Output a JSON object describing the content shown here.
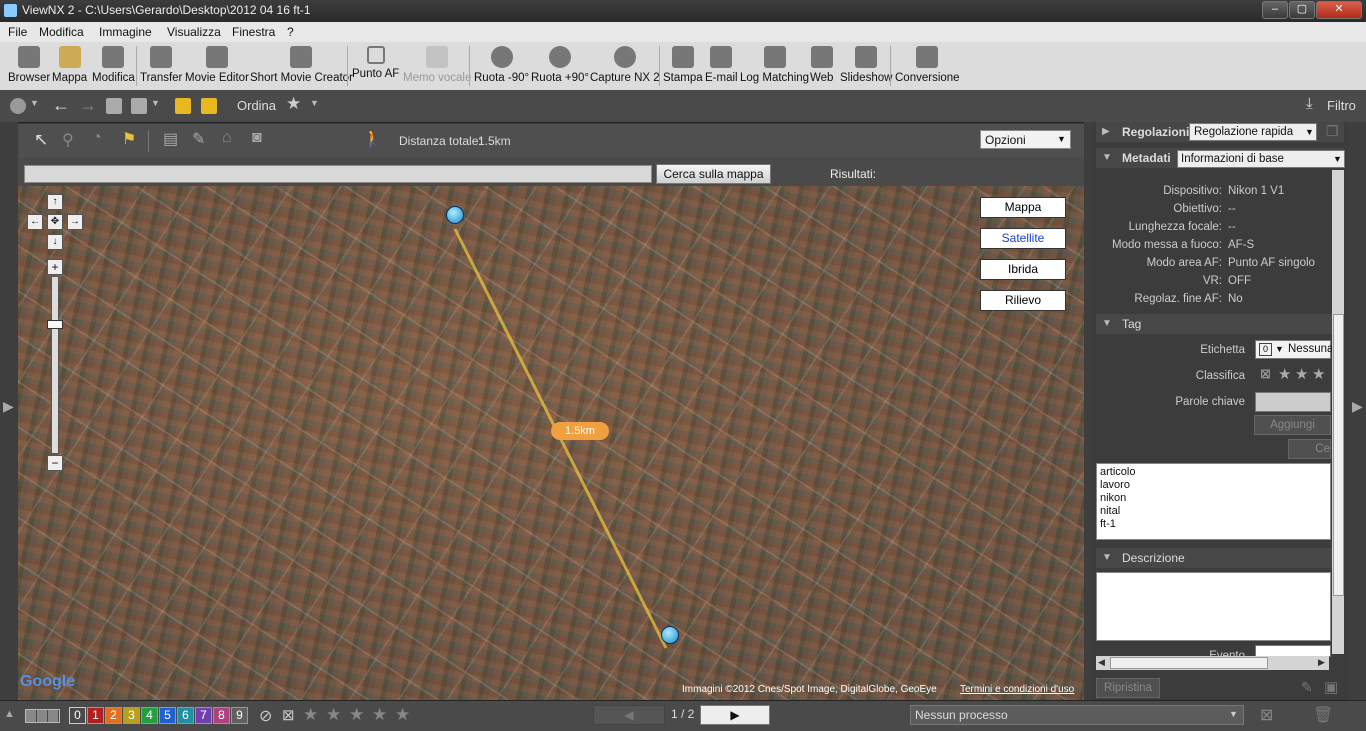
{
  "window": {
    "title": "ViewNX 2 - C:\\Users\\Gerardo\\Desktop\\2012 04 16 ft-1"
  },
  "menu": [
    "File",
    "Modifica",
    "Immagine",
    "Visualizza",
    "Finestra",
    "?"
  ],
  "toolbar": {
    "items": [
      "Browser",
      "Mappa",
      "Modifica",
      "Transfer",
      "Movie Editor",
      "Short Movie Creator",
      "Punto AF",
      "Memo vocale",
      "Ruota -90°",
      "Ruota +90°",
      "Capture NX 2",
      "Stampa",
      "E-mail",
      "Log Matching",
      "Web",
      "Slideshow",
      "Conversione"
    ],
    "disabled": "Memo vocale"
  },
  "bar2": {
    "sort_label": "Ordina",
    "filter_label": "Filtro"
  },
  "map": {
    "distance_label": "Distanza totale:",
    "distance_value": "1.5km",
    "options_label": "Opzioni",
    "search_button": "Cerca sulla mappa",
    "results_label": "Risultati:",
    "map_types": [
      "Mappa",
      "Satellite",
      "Ibrida",
      "Rilievo"
    ],
    "active_type": "Satellite",
    "route_label": "1.5km",
    "google_logo": "Google",
    "copyright": "Immagini ©2012 Cnes/Spot Image, DigitalGlobe, GeoEye",
    "terms": "Termini e condizioni d'uso"
  },
  "panel": {
    "regolazioni_label": "Regolazioni",
    "regolazioni_value": "Regolazione rapida",
    "metadati_label": "Metadati",
    "metadati_value": "Informazioni di base",
    "info_rows": [
      {
        "label": "Dispositivo:",
        "value": "Nikon 1 V1"
      },
      {
        "label": "Obiettivo:",
        "value": "--"
      },
      {
        "label": "Lunghezza focale:",
        "value": "--"
      },
      {
        "label": "Modo messa a fuoco:",
        "value": "AF-S"
      },
      {
        "label": "Modo area AF:",
        "value": "Punto AF singolo"
      },
      {
        "label": "VR:",
        "value": "OFF"
      },
      {
        "label": "Regolaz. fine AF:",
        "value": "No"
      }
    ],
    "tag_section": "Tag",
    "etichetta_label": "Etichetta",
    "etichetta_value": "Nessuna",
    "classifica_label": "Classifica",
    "parole_label": "Parole chiave",
    "add_button": "Aggiungi",
    "del_button": "Ce",
    "keywords": [
      "articolo",
      "lavoro",
      "nikon",
      "nital",
      "ft-1"
    ],
    "descrizione_section": "Descrizione",
    "evento_label": "Evento",
    "ripristina_button": "Ripristina"
  },
  "bottom": {
    "labels": [
      "0",
      "1",
      "2",
      "3",
      "4",
      "5",
      "6",
      "7",
      "8",
      "9"
    ],
    "page": "1 / 2",
    "process": "Nessun processo"
  },
  "colors": {
    "label_colors": [
      "#333333",
      "#b02020",
      "#e07020",
      "#d8c020",
      "#20a040",
      "#2060d0",
      "#20b0c0",
      "#9040c0",
      "#c04080",
      "#707070"
    ],
    "route": "#e8c040",
    "route_badge": "#f0a040"
  }
}
